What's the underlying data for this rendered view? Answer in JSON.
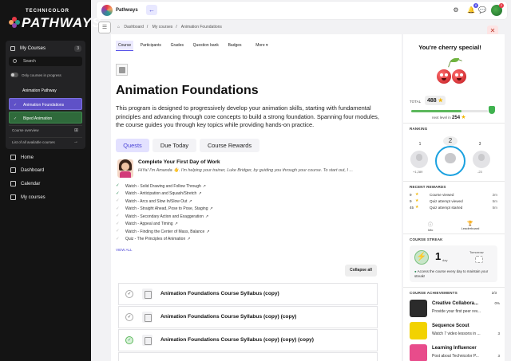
{
  "sidebar": {
    "brand_top": "TECHNICOLOR",
    "brand_main": "PATHWAYS",
    "my_courses_label": "My Courses",
    "my_courses_count": "3",
    "search_placeholder": "Search",
    "toggle_label": "Only courses in progress",
    "courses": [
      "Animation Pathway",
      "Animation Foundations",
      "Biped Animation"
    ],
    "course_overview": "Course overview",
    "list_all": "List of all available courses",
    "nav": [
      "Home",
      "Dashboard",
      "Calendar",
      "My courses"
    ]
  },
  "topbar": {
    "site_name": "Pathways",
    "back_icon": "arrow-left-icon",
    "notif_count": "8",
    "avatar_badge": "2"
  },
  "breadcrumb": [
    "Dashboard",
    "My courses",
    "Animation Foundations"
  ],
  "tabs": [
    "Course",
    "Participants",
    "Grades",
    "Question bank",
    "Badges",
    "More ▾"
  ],
  "course": {
    "title": "Animation Foundations",
    "description": "This program is designed to progressively develop your animation skills, starting with fundamental principles and advancing through core concepts to build a strong foundation. Spanning four modules, the course guides you through key topics while providing hands-on practice."
  },
  "segments": [
    "Quests",
    "Due Today",
    "Course Rewards"
  ],
  "mission": {
    "title": "Complete Your First Day of Work",
    "subtitle": "HiYa! I'm Amanda 👋. I'm helping your trainer, Luke Bridger, by guiding you through your course. To start out, I ..."
  },
  "checklist": [
    {
      "label": "Watch - Solid Drawing and Follow Through",
      "done": true
    },
    {
      "label": "Watch - Anticipation and Squash/Stretch",
      "done": true
    },
    {
      "label": "Watch - Arcs and Slow In/Slow Out",
      "done": false
    },
    {
      "label": "Watch - Straight Ahead, Pose to Pose, Staging",
      "done": false
    },
    {
      "label": "Watch - Secondary Action and Exaggeration",
      "done": false
    },
    {
      "label": "Watch - Appeal and Timing",
      "done": false
    },
    {
      "label": "Watch - Finding the Center of Mass, Balance",
      "done": false
    },
    {
      "label": "Quiz - The Principles of Animation",
      "done": false
    }
  ],
  "view_all": "VIEW ALL",
  "collapse_all": "Collapse all",
  "syllabus": [
    {
      "title": "Animation Foundations Course Syllabus (copy)",
      "done": false
    },
    {
      "title": "Animation Foundations Course Syllabus (copy) (copy)",
      "done": false
    },
    {
      "title": "Animation Foundations Course Syllabus (copy) (copy) (copy)",
      "done": true
    }
  ],
  "right": {
    "title": "You're cherry special!",
    "total_label": "TOTAL",
    "total_value": "488",
    "progress": 0.66,
    "next_level_text": "next level in",
    "next_level_value": "254",
    "ranking_label": "RANKING",
    "ranks": [
      {
        "place": "1",
        "points": "+1,289"
      },
      {
        "place": "2",
        "points": ""
      },
      {
        "place": "3",
        "points": "-23"
      }
    ],
    "recent_label": "RECENT REWARDS",
    "rewards": [
      {
        "n": "9",
        "desc": "Course viewed",
        "time": "2m"
      },
      {
        "n": "9",
        "desc": "Quiz attempt viewed",
        "time": "5m"
      },
      {
        "n": "45",
        "desc": "Quiz attempt started",
        "time": "5m"
      }
    ],
    "info_label": "Info",
    "leaderboard_label": "Leaderboard",
    "streak_label": "COURSE STREAK",
    "streak_value": "1",
    "streak_unit": "day",
    "streak_tomorrow": "Tomorrow",
    "streak_note": "Access the course every day to maintain your streak!",
    "ach_label": "COURSE ACHIEVEMENTS",
    "ach_count": "2/3",
    "achievements": [
      {
        "name": "Creative Collabora...",
        "desc": "Provide your first peer rev...",
        "pct": "0%",
        "time": "",
        "color": "#2b2b2b"
      },
      {
        "name": "Sequence Scout",
        "desc": "Watch 7 video lessons in ...",
        "pct": "",
        "time": "3",
        "color": "#f2d200"
      },
      {
        "name": "Learning Influencer",
        "desc": "Post about Technicolor P...",
        "pct": "",
        "time": "3",
        "color": "#e84c8b"
      }
    ]
  }
}
